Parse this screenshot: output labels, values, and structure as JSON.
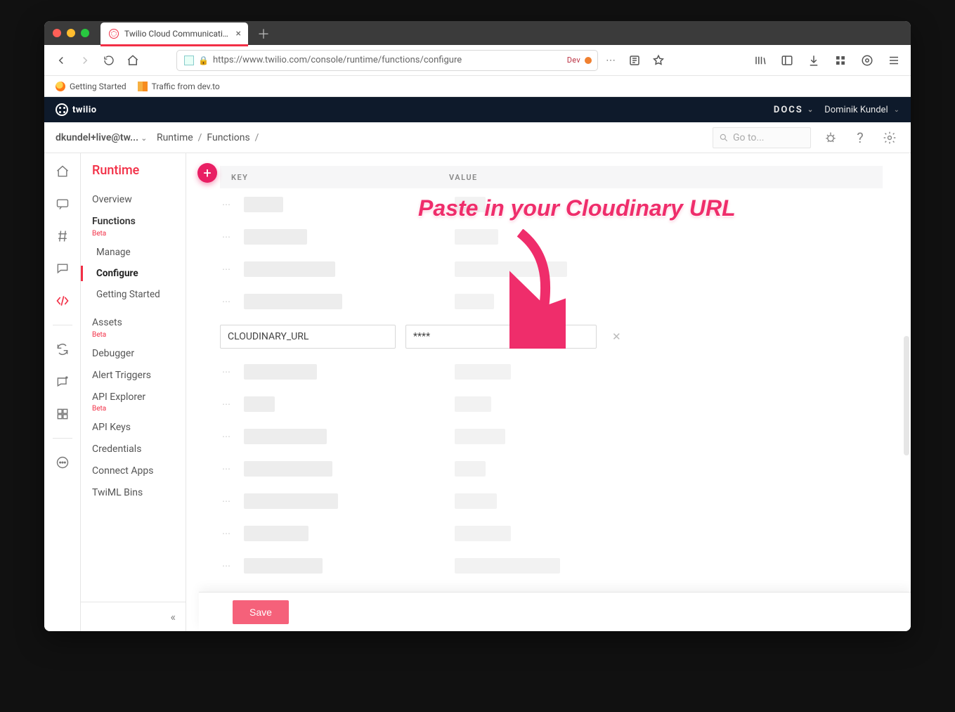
{
  "chrome": {
    "tab_title": "Twilio Cloud Communications |",
    "url": "https://www.twilio.com/console/runtime/functions/configure",
    "dev_label": "Dev",
    "bookmarks": {
      "getting_started": "Getting Started",
      "dev_to": "Traffic from dev.to"
    }
  },
  "topnav": {
    "brand": "twilio",
    "docs": "DOCS",
    "user": "Dominik Kundel"
  },
  "subnav": {
    "account": "dkundel+live@tw...",
    "crumb_runtime": "Runtime",
    "crumb_functions": "Functions",
    "search_placeholder": "Go to..."
  },
  "sidenav": {
    "title": "Runtime",
    "overview": "Overview",
    "functions": "Functions",
    "beta": "Beta",
    "manage": "Manage",
    "configure": "Configure",
    "getting_started": "Getting Started",
    "assets": "Assets",
    "debugger": "Debugger",
    "alert_triggers": "Alert Triggers",
    "api_explorer": "API Explorer",
    "api_keys": "API Keys",
    "credentials": "Credentials",
    "connect_apps": "Connect Apps",
    "twiml_bins": "TwiML Bins"
  },
  "table": {
    "col_key": "KEY",
    "col_value": "VALUE",
    "blurred_rows": [
      {
        "k_w": 56,
        "v_w": 44
      },
      {
        "k_w": 90,
        "v_w": 62
      },
      {
        "k_w": 130,
        "v_w": 160
      },
      {
        "k_w": 140,
        "v_w": 56
      }
    ],
    "blurred_rows_below": [
      {
        "k_w": 104,
        "v_w": 80
      },
      {
        "k_w": 44,
        "v_w": 52
      },
      {
        "k_w": 118,
        "v_w": 72
      },
      {
        "k_w": 126,
        "v_w": 44
      },
      {
        "k_w": 134,
        "v_w": 60
      },
      {
        "k_w": 92,
        "v_w": 80
      },
      {
        "k_w": 112,
        "v_w": 150
      }
    ],
    "editable": {
      "key": "CLOUDINARY_URL",
      "value": "****"
    }
  },
  "footer": {
    "save": "Save"
  },
  "annotation": {
    "text": "Paste in your Cloudinary URL"
  }
}
